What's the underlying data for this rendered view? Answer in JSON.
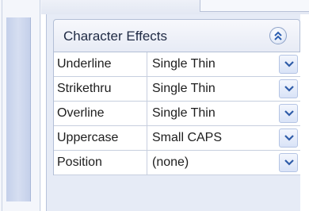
{
  "section": {
    "title": "Character Effects",
    "collapse_icon": "double-chevron-up-icon"
  },
  "rows": [
    {
      "label": "Underline",
      "value": "Single Thin"
    },
    {
      "label": "Strikethru",
      "value": "Single Thin"
    },
    {
      "label": "Overline",
      "value": "Single Thin"
    },
    {
      "label": "Uppercase",
      "value": "Small CAPS"
    },
    {
      "label": "Position",
      "value": "(none)"
    }
  ],
  "colors": {
    "panel_bg": "#e6ebf6",
    "chevron": "#2d5fb0",
    "dropdown_arrow": "#2f5ca8"
  }
}
